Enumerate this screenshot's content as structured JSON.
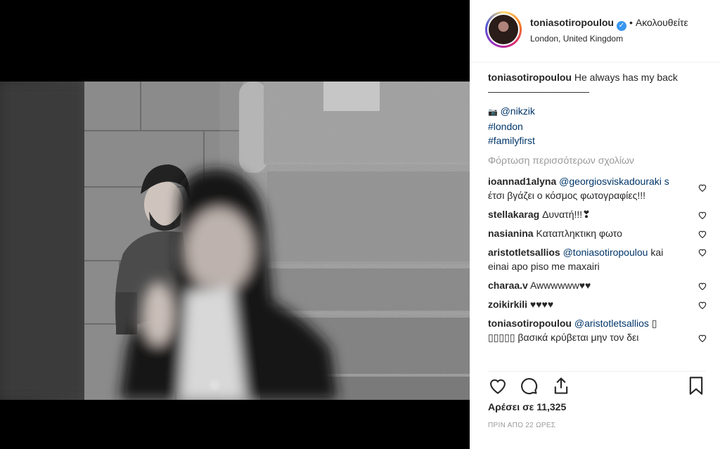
{
  "post": {
    "username": "toniasotiropoulou",
    "verified_icon": "verified-badge-icon",
    "separator": "•",
    "follow_label": "Ακολουθείτε",
    "location": "London, United Kingdom"
  },
  "caption": {
    "username": "toniasotiropoulou",
    "text": "He always has my back",
    "rule": "———————————",
    "camera_prefix": "📷",
    "mention": "@nikzik",
    "tags": [
      "#london",
      "#familyfirst"
    ]
  },
  "load_more": "Φόρτωση περισσότερων σχολίων",
  "comments": [
    {
      "user": "ioannad1alyna",
      "mention": "@georgiosviskadouraki s",
      "text": " έτσι βγάζει ο κόσμος φωτογραφίες!!!"
    },
    {
      "user": "stellakarag",
      "mention": "",
      "text": "Δυνατή!!!❣"
    },
    {
      "user": "nasianina",
      "mention": "",
      "text": "Καταπληκτικη φωτο"
    },
    {
      "user": "aristotletsallios",
      "mention": "@toniasotiropoulou",
      "text": " kai einai apo piso me maxairi"
    },
    {
      "user": "charaa.v",
      "mention": "",
      "text": "Awwwwww♥♥"
    },
    {
      "user": "zoikirkili",
      "mention": "",
      "text": "♥♥♥♥"
    },
    {
      "user": "toniasotiropoulou",
      "mention": "@aristotletsallios",
      "text": " ▯ ▯▯▯▯▯ βασικά κρύβεται μην τον δει"
    }
  ],
  "likes": "Αρέσει σε 11,325",
  "timestamp": "ΠΡΙΝ ΑΠΟ 22 ΩΡΕΣ",
  "colors": {
    "link": "#003569",
    "verified": "#3897f0",
    "muted": "#999999"
  }
}
